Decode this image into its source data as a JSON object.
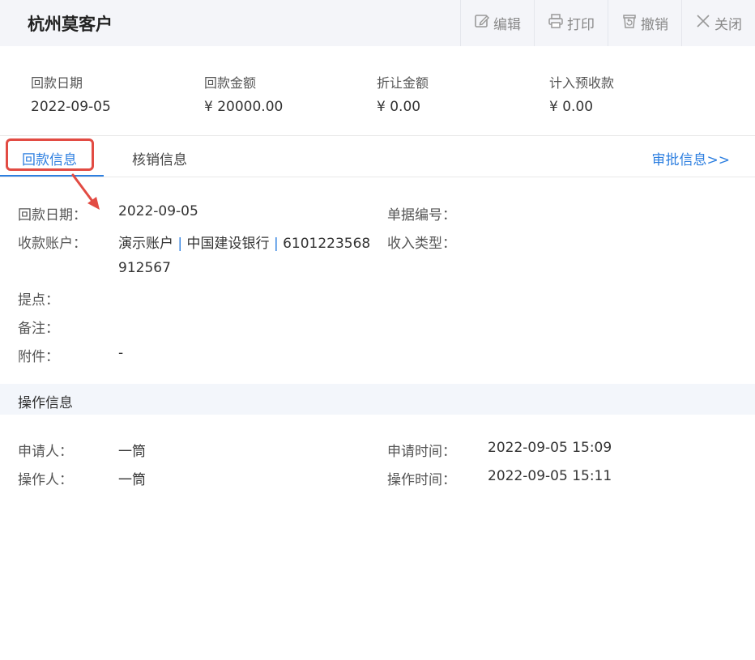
{
  "header": {
    "title": "杭州莫客户",
    "buttons": {
      "edit": "编辑",
      "print": "打印",
      "revoke": "撤销",
      "close": "关闭"
    }
  },
  "summary": {
    "date_label": "回款日期",
    "date_value": "2022-09-05",
    "amount_label": "回款金额",
    "amount_value": "¥ 20000.00",
    "discount_label": "折让金额",
    "discount_value": "¥ 0.00",
    "prepay_label": "计入预收款",
    "prepay_value": "¥ 0.00"
  },
  "tabs": {
    "payment_info": "回款信息",
    "writeoff_info": "核销信息",
    "approval_link": "审批信息>>"
  },
  "details": {
    "date_label": "回款日期：",
    "date_value": "2022-09-05",
    "doc_no_label": "单据编号：",
    "account_label": "收款账户：",
    "account_name": "演示账户",
    "account_sep": "|",
    "account_bank": "中国建设银行",
    "account_no_part1": "6101223568",
    "account_no_part2": "912567",
    "income_type_label": "收入类型：",
    "points_label": "提点：",
    "remarks_label": "备注：",
    "attachment_label": "附件：",
    "attachment_value": "-"
  },
  "operation": {
    "section_title": "操作信息",
    "applicant_label": "申请人：",
    "applicant_value": "一筒",
    "apply_time_label": "申请时间：",
    "apply_time_value": "2022-09-05 15:09",
    "operator_label": "操作人：",
    "operator_value": "一筒",
    "operate_time_label": "操作时间：",
    "operate_time_value": "2022-09-05 15:11"
  },
  "colors": {
    "accent": "#2d7fe0",
    "highlight": "#e24b43"
  }
}
